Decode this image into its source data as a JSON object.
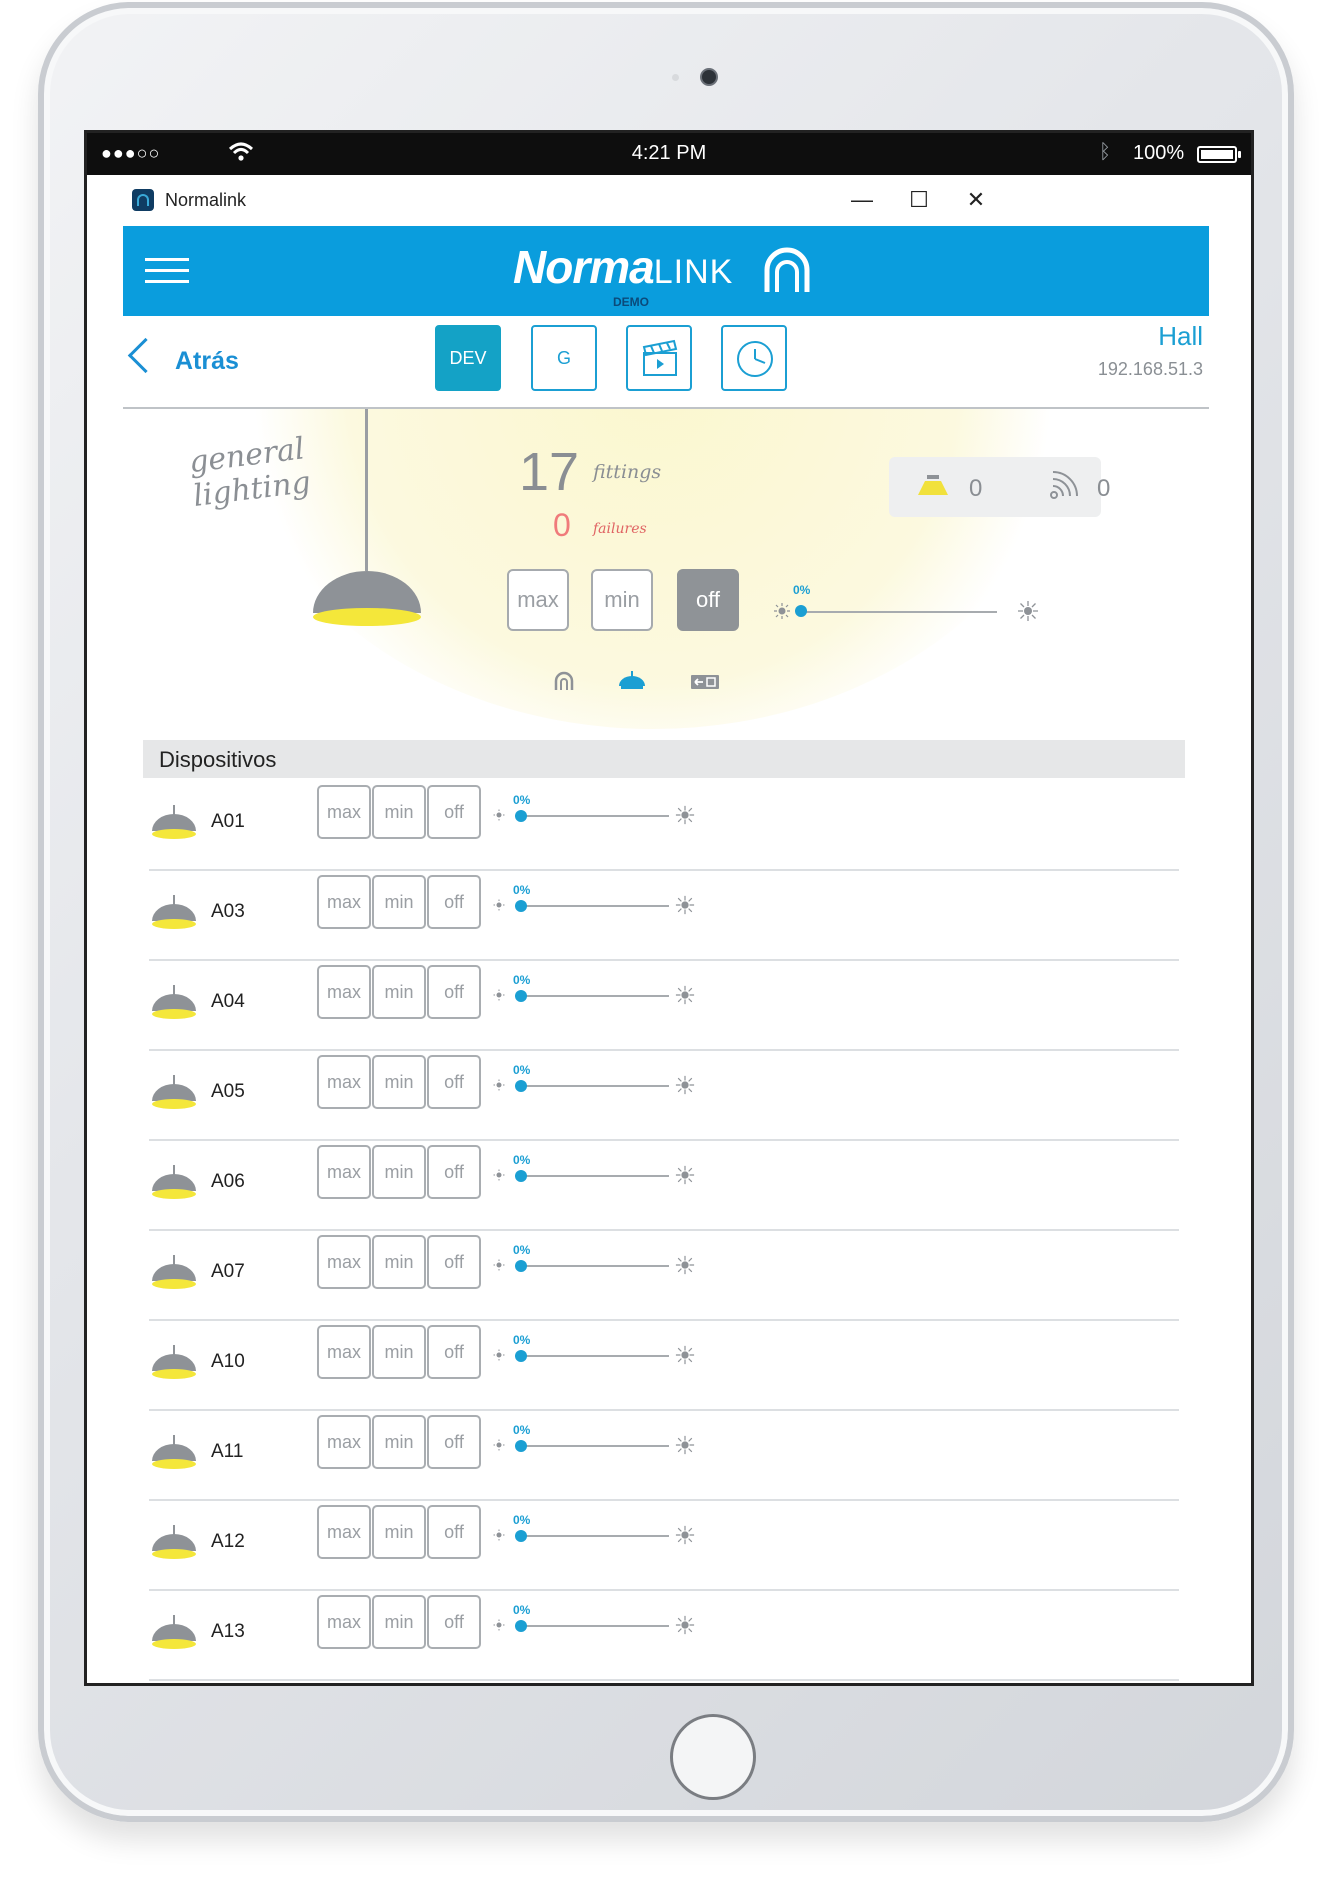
{
  "status_bar": {
    "signal": "●●●○○",
    "time": "4:21 PM",
    "battery": "100%"
  },
  "window": {
    "title": "Normalink",
    "minimize": "—",
    "maximize": "☐",
    "close": "✕"
  },
  "header": {
    "brand_bold": "Norma",
    "brand_light": "LINK",
    "brand_sub": "DEMO",
    "accent": "#0a9ddd"
  },
  "toolbar": {
    "back_label": "Atrás",
    "tabs": [
      {
        "label": "DEV",
        "icon": "dev-tab",
        "active": true
      },
      {
        "label": "G",
        "icon": "group-tab",
        "active": false
      },
      {
        "label": "",
        "icon": "scene-clapper-icon",
        "active": false
      },
      {
        "label": "",
        "icon": "clock-icon",
        "active": false
      }
    ],
    "location": "Hall",
    "ip": "192.168.51.3"
  },
  "overview": {
    "title_line1": "general",
    "title_line2": "lighting",
    "fittings_count": "17",
    "fittings_label": "fittings",
    "failures_count": "0",
    "failures_label": "failures",
    "buttons": {
      "max": "max",
      "min": "min",
      "off": "off"
    },
    "active_button": "off",
    "level_label": "0%",
    "level": 0,
    "stats": {
      "lamps": "0",
      "emergency": "0"
    }
  },
  "devices_header": "Dispositivos",
  "device_buttons": {
    "max": "max",
    "min": "min",
    "off": "off"
  },
  "devices": [
    {
      "name": "A01",
      "level_label": "0%",
      "level": 0
    },
    {
      "name": "A03",
      "level_label": "0%",
      "level": 0
    },
    {
      "name": "A04",
      "level_label": "0%",
      "level": 0
    },
    {
      "name": "A05",
      "level_label": "0%",
      "level": 0
    },
    {
      "name": "A06",
      "level_label": "0%",
      "level": 0
    },
    {
      "name": "A07",
      "level_label": "0%",
      "level": 0
    },
    {
      "name": "A10",
      "level_label": "0%",
      "level": 0
    },
    {
      "name": "A11",
      "level_label": "0%",
      "level": 0
    },
    {
      "name": "A12",
      "level_label": "0%",
      "level": 0
    },
    {
      "name": "A13",
      "level_label": "0%",
      "level": 0
    }
  ]
}
